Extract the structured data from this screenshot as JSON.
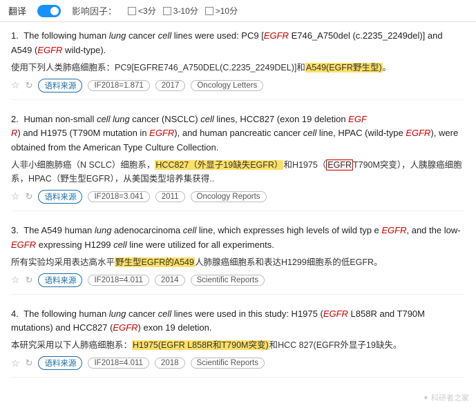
{
  "topbar": {
    "translate_label": "翻译",
    "toggle_state": "on",
    "filter_label": "影响因子：",
    "filters": [
      {
        "label": "<3分",
        "checked": false
      },
      {
        "label": "3-10分",
        "checked": false
      },
      {
        "label": ">10分",
        "checked": false
      }
    ]
  },
  "results": [
    {
      "number": "1.",
      "english": "The following human lung cancer cell lines were used: PC9 [EGFR E746_A750del (c.2235_2249del)] and A549 (EGFR wild-type).",
      "chinese": "使用下列人类肺癌细胞系：PC9[EGFRE746_A750DEL(C.2235_2249DEL)]和A549(EGFR野生型)。",
      "highlight_cn": "A549(EGFR野生型)",
      "stars": "☆",
      "source_label": "语料来源",
      "if_label": "IF2018=1.871",
      "year": "2017",
      "journal": "Oncology Letters"
    },
    {
      "number": "2.",
      "english": "Human non-small cell lung cancer (NSCLC) cell lines, HCC827 (exon 19 deletion EGFR) and H1975 (T790M mutation in EGFR), and human pancreatic cancer cell line, HPAC (wild-type EGFR), were obtained from the American Type Culture Collection.",
      "chinese": "人非小细胞肺癌（N SCLC）细胞系，HCC827（外显子19缺失EGFR）和H1975（EGFR T790M突变），人胰腺癌细胞系，HPAC（野生型EGFR），从美国类型培养集获得..",
      "highlight_cn1": "HCC827（外显子19缺失EGFR）",
      "highlight_cn2": "H1975（EGFR",
      "stars": "☆",
      "source_label": "语料来源",
      "if_label": "IF2018=3.041",
      "year": "2011",
      "journal": "Oncology Reports"
    },
    {
      "number": "3.",
      "english": "The A549 human lung adenocarcinoma cell line, which expresses high levels of wild type EGFR, and the low-EGFR expressing H1299 cell line were utilized for all experiments.",
      "chinese": "所有实验均采用表达高水平野生型EGFR的A549人肺腺癌细胞系和表达H1299细胞系的低EGFR。",
      "highlight_cn": "野生型EGFR的A549",
      "stars": "☆",
      "source_label": "语料来源",
      "if_label": "IF2018=4.011",
      "year": "2014",
      "journal": "Scientific Reports"
    },
    {
      "number": "4.",
      "english": "The following human lung cancer cell lines were used in this study: H1975 (EGFR L858R and T790M mutations) and HCC827 (EGFR exon 19 deletion.",
      "chinese": "本研究采用以下人肺癌细胞系：H1975(EGFR L858R和T790M突变)和HCC 827(EGFR外显子19缺失。",
      "highlight_cn": "H1975(EGFR L858R和T790M突变)",
      "stars": "☆",
      "source_label": "语料来源",
      "if_label": "IF2018=4.011",
      "year": "2018",
      "journal": "Scientific Reports"
    }
  ],
  "watermark": "✦ 科研者之家"
}
